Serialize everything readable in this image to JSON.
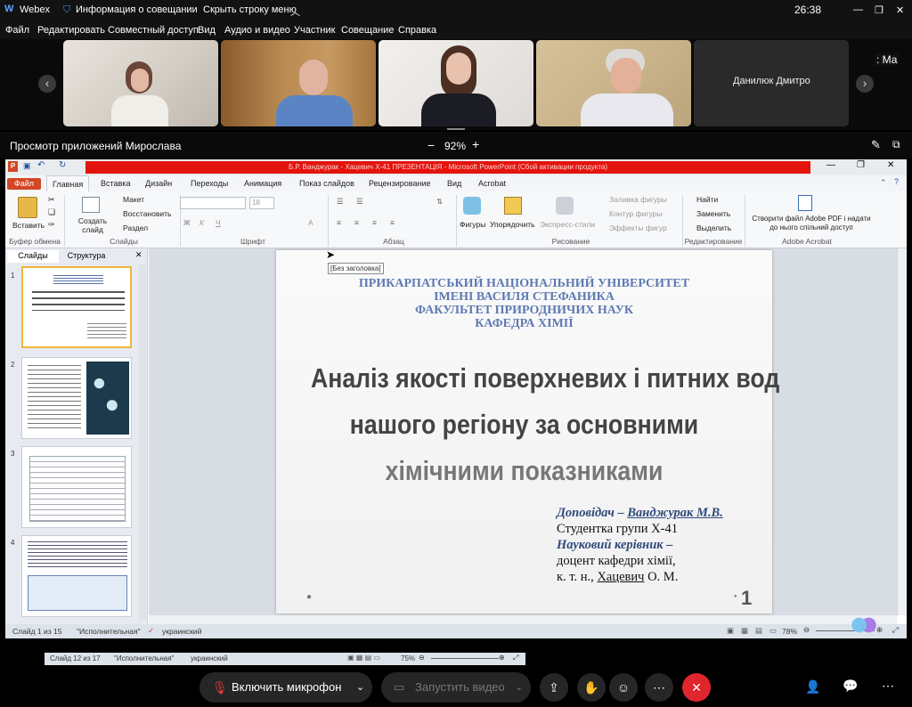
{
  "topbar": {
    "app": "Webex",
    "meeting_info": "Информация о совещании",
    "hide_menu": "Скрыть строку меню",
    "timer": "26:38"
  },
  "menu": [
    "Файл",
    "Редактировать",
    "Совместный доступ",
    "Вид",
    "Аудио и видео",
    "Участник",
    "Совещание",
    "Справка"
  ],
  "participants": {
    "name_tile": "Данилюк Дмитро",
    "overflow": ": Ма"
  },
  "share": {
    "label": "Просмотр приложений Мирослава",
    "zoom": "92%",
    "minus": "−",
    "plus": "+"
  },
  "ppt": {
    "title": "Б.Р. Ванджурак - Хацевич Х-41 ПРЕЗЕНТАЦІЯ - Microsoft PowerPoint (Сбой активации продукта)",
    "tabs": [
      "Файл",
      "Главная",
      "Вставка",
      "Дизайн",
      "Переходы",
      "Анимация",
      "Показ слайдов",
      "Рецензирование",
      "Вид",
      "Acrobat"
    ],
    "ribbon": {
      "paste": "Вставить",
      "create_slide": "Создать слайд",
      "layout": "Макет",
      "reset": "Восстановить",
      "section": "Раздел",
      "font_size": "18",
      "shapes": "Фигуры",
      "arrange": "Упорядочить",
      "quick_styles": "Экспресс-стили",
      "fill": "Заливка фигуры",
      "outline": "Контур фигуры",
      "effects": "Эффекты фигур",
      "find": "Найти",
      "replace": "Заменить",
      "select": "Выделить",
      "acrobat_btn": "Створити файл Adobe PDF і надати до нього спільний доступ",
      "groups": [
        "Буфер обмена",
        "Слайды",
        "Шрифт",
        "Абзац",
        "Рисование",
        "Редактирование",
        "Adobe Acrobat"
      ]
    },
    "pane_tabs": [
      "Слайды",
      "Структура"
    ],
    "tooltip": "[Без заголовка]",
    "slide": {
      "header": [
        "ПРИКАРПАТСЬКИЙ НАЦІОНАЛЬНИЙ УНІВЕРСИТЕТ",
        "ІМЕНІ ВАСИЛЯ СТЕФАНИКА",
        "ФАКУЛЬТЕТ ПРИРОДНИЧИХ НАУК",
        "КАФЕДРА ХІМІЇ"
      ],
      "title": [
        "Аналіз якості поверхневих і питних вод",
        "нашого регіону за основними",
        "хімічними показниками"
      ],
      "speaker_label": "Доповідач – ",
      "speaker_name": "Ванджурак М.В.",
      "group": "Студентка групи Х-41",
      "advisor_label": "Науковий керівник –",
      "advisor_line1": "доцент кафедри хімії,",
      "advisor_line2_prefix": "к. т. н., ",
      "advisor_name": "Хацевич",
      "advisor_initials": " О. М.",
      "number": "1"
    },
    "status": {
      "slide": "Слайд 1 из 15",
      "theme": "\"Исполнительная\"",
      "lang": "украинский",
      "zoom": "78%"
    }
  },
  "status2": {
    "slide": "Слайд 12 из 17",
    "theme": "\"Исполнительная\"",
    "lang": "украинский",
    "zoom": "75%"
  },
  "controls": {
    "mic": "Включить микрофон",
    "video": "Запустить видео"
  }
}
